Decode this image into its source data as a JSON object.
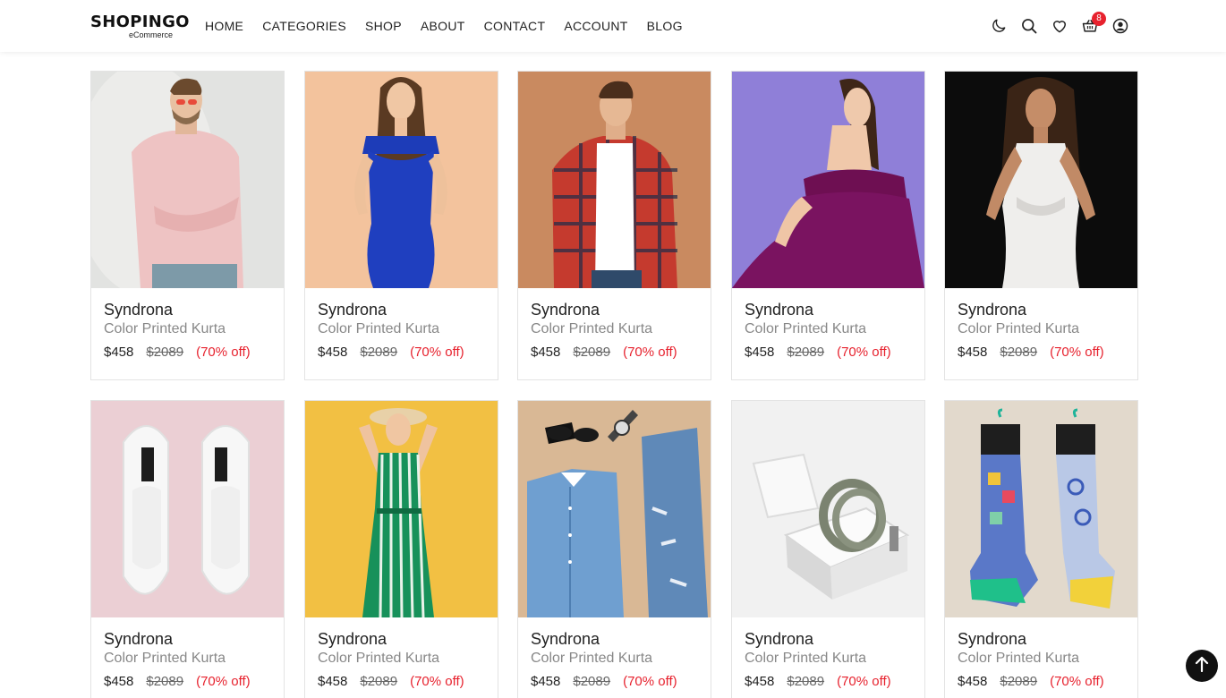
{
  "header": {
    "logo_main": "SHOPINGO",
    "logo_sub": "eCommerce",
    "nav": [
      "HOME",
      "CATEGORIES",
      "SHOP",
      "ABOUT",
      "CONTACT",
      "ACCOUNT",
      "BLOG"
    ],
    "icons": [
      "moon-icon",
      "search-icon",
      "heart-icon",
      "cart-icon",
      "user-icon"
    ],
    "cart_count": "8"
  },
  "products": [
    {
      "brand": "Syndrona",
      "title": "Color Printed Kurta",
      "price": "$458",
      "old_price": "$2089",
      "discount": "(70% off)",
      "image": "man in pink sweater"
    },
    {
      "brand": "Syndrona",
      "title": "Color Printed Kurta",
      "price": "$458",
      "old_price": "$2089",
      "discount": "(70% off)",
      "image": "woman in blue dress"
    },
    {
      "brand": "Syndrona",
      "title": "Color Printed Kurta",
      "price": "$458",
      "old_price": "$2089",
      "discount": "(70% off)",
      "image": "man in plaid shirt"
    },
    {
      "brand": "Syndrona",
      "title": "Color Printed Kurta",
      "price": "$458",
      "old_price": "$2089",
      "discount": "(70% off)",
      "image": "woman in purple dress"
    },
    {
      "brand": "Syndrona",
      "title": "Color Printed Kurta",
      "price": "$458",
      "old_price": "$2089",
      "discount": "(70% off)",
      "image": "woman in white dress"
    },
    {
      "brand": "Syndrona",
      "title": "Color Printed Kurta",
      "price": "$458",
      "old_price": "$2089",
      "discount": "(70% off)",
      "image": "white slip-on shoes"
    },
    {
      "brand": "Syndrona",
      "title": "Color Printed Kurta",
      "price": "$458",
      "old_price": "$2089",
      "discount": "(70% off)",
      "image": "woman in green striped dress"
    },
    {
      "brand": "Syndrona",
      "title": "Color Printed Kurta",
      "price": "$458",
      "old_price": "$2089",
      "discount": "(70% off)",
      "image": "denim shirt and jeans"
    },
    {
      "brand": "Syndrona",
      "title": "Color Printed Kurta",
      "price": "$458",
      "old_price": "$2089",
      "discount": "(70% off)",
      "image": "belt in gift box"
    },
    {
      "brand": "Syndrona",
      "title": "Color Printed Kurta",
      "price": "$458",
      "old_price": "$2089",
      "discount": "(70% off)",
      "image": "patterned socks"
    }
  ],
  "colors": {
    "accent": "#e7222e",
    "text": "#222222",
    "muted": "#888888"
  }
}
